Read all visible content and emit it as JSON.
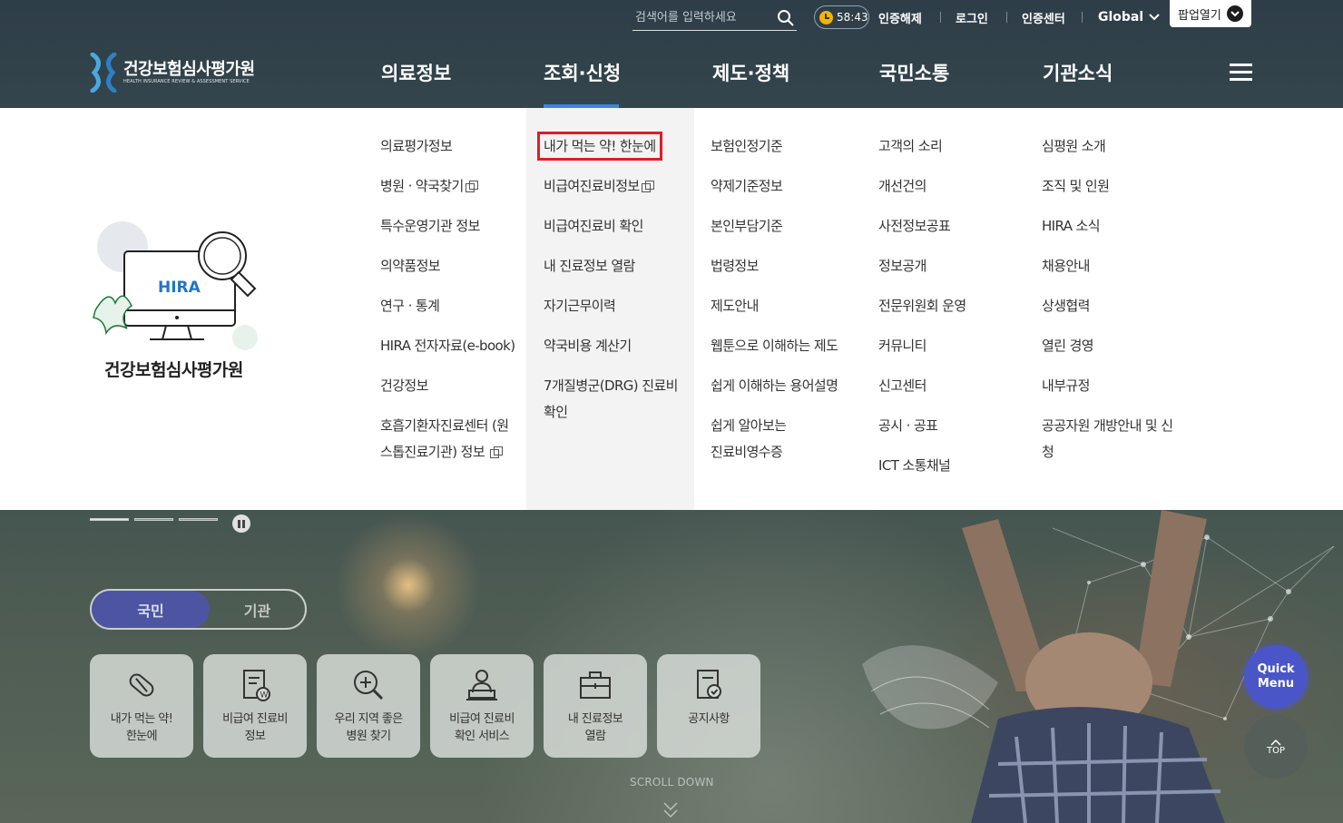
{
  "search": {
    "placeholder": "검색어를 입력하세요"
  },
  "util": {
    "timer": "58:43",
    "cert_release": "인증해제",
    "login": "로그인",
    "cert_center": "인증센터",
    "global": "Global",
    "popup_open": "팝업열기"
  },
  "logo": {
    "name": "건강보험심사평가원",
    "sub": "HEALTH INSURANCE REVIEW & ASSESSMENT SERVICE"
  },
  "gnb": [
    "의료정보",
    "조회·신청",
    "제도·정책",
    "국민소통",
    "기관소식"
  ],
  "mega": {
    "col1": [
      "의료평가정보",
      "병원 · 약국찾기",
      "특수운영기관 정보",
      "의약품정보",
      "연구 · 통계",
      "HIRA 전자자료(e-book)",
      "건강정보",
      "호흡기환자진료센터 (원스톱진료기관) 정보"
    ],
    "col2": [
      "내가 먹는 약! 한눈에",
      "비급여진료비정보",
      "비급여진료비 확인",
      "내 진료정보 열람",
      "자기근무이력",
      "약국비용 계산기",
      "7개질병군(DRG) 진료비 확인"
    ],
    "col3": [
      "보험인정기준",
      "약제기준정보",
      "본인부담기준",
      "법령정보",
      "제도안내",
      "웹툰으로 이해하는 제도",
      "쉽게 이해하는 용어설명",
      "쉽게 알아보는 진료비영수증"
    ],
    "col4": [
      "고객의 소리",
      "개선건의",
      "사전정보공표",
      "정보공개",
      "전문위원회 운영",
      "커뮤니티",
      "신고센터",
      "공시 · 공표",
      "ICT 소통채널"
    ],
    "col5": [
      "심평원 소개",
      "조직 및 인원",
      "HIRA 소식",
      "채용안내",
      "상생협력",
      "열린 경영",
      "내부규정",
      "공공자원 개방안내 및 신청"
    ],
    "illust_badge": "HIRA",
    "illust_title": "건강보험심사평가원"
  },
  "toggle": {
    "on": "국민",
    "off": "기관"
  },
  "tiles": [
    {
      "label": "내가 먹는 약!\n한눈에",
      "icon": "pill-icon"
    },
    {
      "label": "비급여 진료비\n정보",
      "icon": "document-won-icon"
    },
    {
      "label": "우리 지역 좋은\n병원 찾기",
      "icon": "magnifier-plus-icon"
    },
    {
      "label": "비급여 진료비\n확인 서비스",
      "icon": "person-laptop-icon"
    },
    {
      "label": "내 진료정보\n열람",
      "icon": "briefcase-icon"
    },
    {
      "label": "공지사항",
      "icon": "notice-document-icon"
    }
  ],
  "scroll_down": "SCROLL DOWN",
  "quick_menu": "Quick\nMenu",
  "top": "TOP",
  "colors": {
    "accent_blue": "#3b86e0",
    "highlight_red": "#e21c24",
    "toggle_active": "#4d55a3",
    "quick_menu": "#4a56c8"
  }
}
